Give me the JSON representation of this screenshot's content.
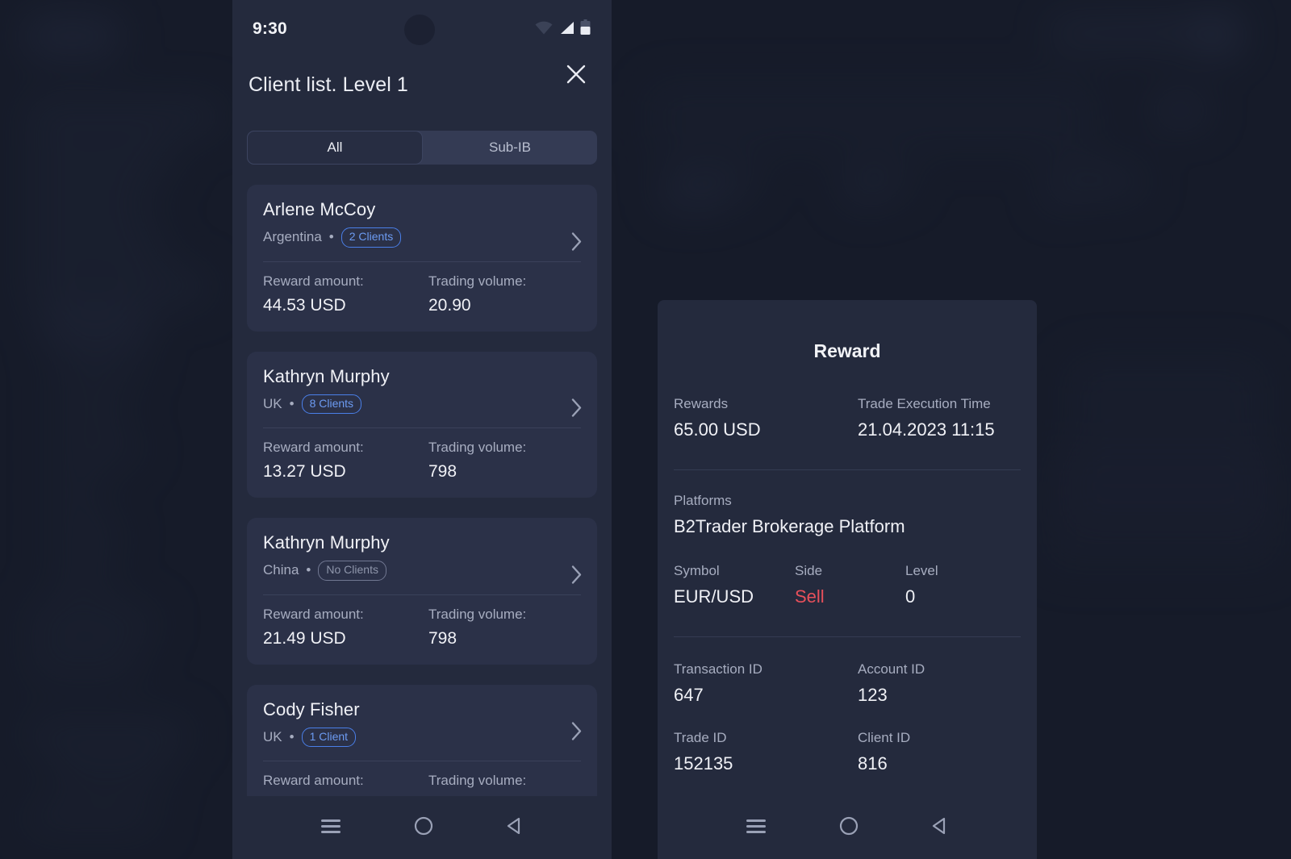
{
  "left_phone": {
    "status_bar": {
      "time": "9:30",
      "icons": [
        "wifi-icon",
        "cellular-signal-icon",
        "battery-icon"
      ]
    },
    "sheet": {
      "title": "Client list. Level 1",
      "close_icon": "close-icon"
    },
    "segmented_control": {
      "options": [
        {
          "label": "All",
          "selected": true
        },
        {
          "label": "Sub-IB",
          "selected": false
        }
      ]
    },
    "labels": {
      "reward_amount": "Reward amount:",
      "trading_volume": "Trading volume:"
    },
    "clients": [
      {
        "name": "Arlene McCoy",
        "country": "Argentina",
        "badge": "2 Clients",
        "badge_style": "blue",
        "reward_amount": "44.53 USD",
        "trading_volume": "20.90"
      },
      {
        "name": "Kathryn Murphy",
        "country": "UK",
        "badge": "8 Clients",
        "badge_style": "blue",
        "reward_amount": "13.27 USD",
        "trading_volume": "798"
      },
      {
        "name": "Kathryn Murphy",
        "country": "China",
        "badge": "No Clients",
        "badge_style": "muted",
        "reward_amount": "21.49 USD",
        "trading_volume": "798"
      },
      {
        "name": "Cody Fisher",
        "country": "UK",
        "badge": "1 Client",
        "badge_style": "blue",
        "reward_amount": "",
        "trading_volume": ""
      }
    ],
    "nav_bar": [
      "recents-icon",
      "home-icon",
      "back-icon"
    ]
  },
  "right_phone": {
    "title": "Reward",
    "fields": {
      "rewards_label": "Rewards",
      "rewards_value": "65.00 USD",
      "trade_execution_time_label": "Trade Execution Time",
      "trade_execution_time_value": "21.04.2023 11:15",
      "platforms_label": "Platforms",
      "platforms_value": "B2Trader Brokerage Platform",
      "symbol_label": "Symbol",
      "symbol_value": "EUR/USD",
      "side_label": "Side",
      "side_value": "Sell",
      "level_label": "Level",
      "level_value": "0",
      "transaction_id_label": "Transaction ID",
      "transaction_id_value": "647",
      "account_id_label": "Account ID",
      "account_id_value": "123",
      "trade_id_label": "Trade ID",
      "trade_id_value": "152135",
      "client_id_label": "Client ID",
      "client_id_value": "816"
    },
    "nav_bar": [
      "recents-icon",
      "home-icon",
      "back-icon"
    ]
  },
  "colors": {
    "page_background": "#161b29",
    "panel_background": "#242a3d",
    "card_background": "#2b3148",
    "accent_blue": "#6c9bf2",
    "sell_red": "#e8505b",
    "text_primary": "#f0f1f6",
    "text_secondary": "#a7adc0"
  }
}
